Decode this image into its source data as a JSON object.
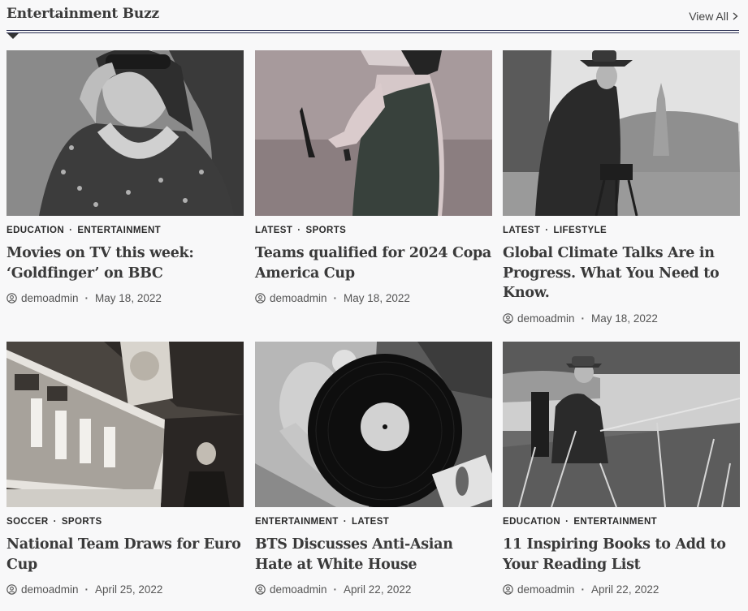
{
  "section": {
    "title": "Entertainment Buzz",
    "view_all": "View All"
  },
  "posts": [
    {
      "cat1": "EDUCATION",
      "cat2": "ENTERTAINMENT",
      "title": "Movies on TV this week: ‘Goldfinger’ on BBC",
      "author": "demoadmin",
      "date": "May 18, 2022"
    },
    {
      "cat1": "LATEST",
      "cat2": "SPORTS",
      "title": "Teams qualified for 2024 Copa America Cup",
      "author": "demoadmin",
      "date": "May 18, 2022"
    },
    {
      "cat1": "LATEST",
      "cat2": "LIFESTYLE",
      "title": "Global Climate Talks Are in Progress. What You Need to Know.",
      "author": "demoadmin",
      "date": "May 18, 2022"
    },
    {
      "cat1": "SOCCER",
      "cat2": "SPORTS",
      "title": "National Team Draws for Euro Cup",
      "author": "demoadmin",
      "date": "April 25, 2022"
    },
    {
      "cat1": "ENTERTAINMENT",
      "cat2": "LATEST",
      "title": "BTS Discusses Anti-Asian Hate at White House",
      "author": "demoadmin",
      "date": "April 22, 2022"
    },
    {
      "cat1": "EDUCATION",
      "cat2": "ENTERTAINMENT",
      "title": "11 Inspiring Books to Add to Your Reading List",
      "author": "demoadmin",
      "date": "April 22, 2022"
    }
  ]
}
